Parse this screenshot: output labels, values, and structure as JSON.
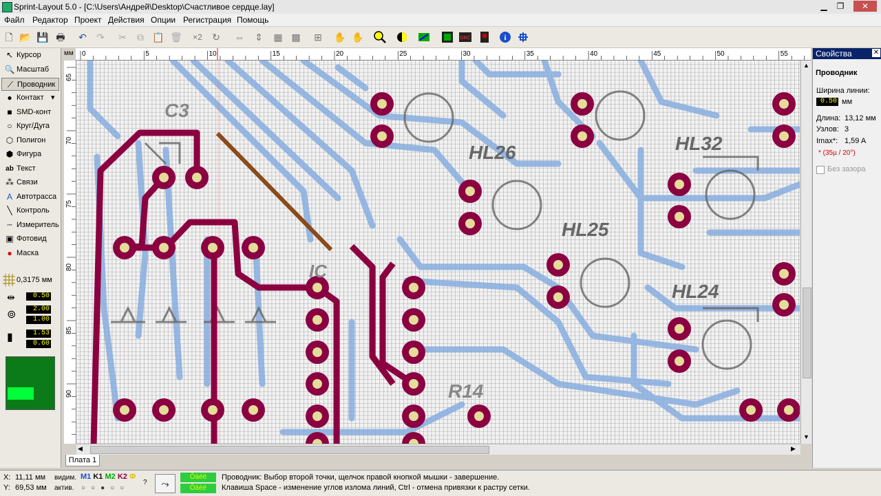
{
  "window": {
    "title": "Sprint-Layout 5.0 - [C:\\Users\\Андрей\\Desktop\\Счастливое сердце.lay]"
  },
  "menu": [
    "Файл",
    "Редактор",
    "Проект",
    "Действия",
    "Опции",
    "Регистрация",
    "Помощь"
  ],
  "toolbar": {
    "x2_label": "×2"
  },
  "tools": [
    {
      "label": "Курсор",
      "icon": "cursor-icon"
    },
    {
      "label": "Масштаб",
      "icon": "zoom-icon"
    },
    {
      "label": "Проводник",
      "icon": "track-icon"
    },
    {
      "label": "Контакт",
      "icon": "pad-icon"
    },
    {
      "label": "SMD-конт",
      "icon": "smd-icon"
    },
    {
      "label": "Круг/Дуга",
      "icon": "circle-icon"
    },
    {
      "label": "Полигон",
      "icon": "polygon-icon"
    },
    {
      "label": "Фигура",
      "icon": "shape-icon"
    },
    {
      "label": "Текст",
      "icon": "text-icon"
    },
    {
      "label": "Связи",
      "icon": "connections-icon"
    },
    {
      "label": "Автотрасса",
      "icon": "autoroute-icon"
    },
    {
      "label": "Контроль",
      "icon": "check-icon"
    },
    {
      "label": "Измеритель",
      "icon": "measure-icon"
    },
    {
      "label": "Фотовид",
      "icon": "photoview-icon"
    },
    {
      "label": "Маска",
      "icon": "mask-icon"
    }
  ],
  "grid": {
    "value": "0,3175 мм"
  },
  "track_width": "0.50",
  "pad_outer": "2.00",
  "pad_inner": "1.00",
  "smd_w": "1.53",
  "smd_h": "0.60",
  "ruler": {
    "unit": "мм",
    "h_labels": [
      "0",
      "5",
      "10",
      "15",
      "20",
      "25",
      "30",
      "35",
      "40",
      "45",
      "50",
      "55"
    ],
    "v_labels": [
      "65",
      "70",
      "75",
      "80",
      "85",
      "90"
    ]
  },
  "silk": {
    "labels": [
      "C3",
      "HL26",
      "HL25",
      "HL24",
      "HL32",
      "R14",
      "IC"
    ]
  },
  "tabs": {
    "board1": "Плата 1"
  },
  "props": {
    "header": "Свойства",
    "title": "Проводник",
    "width_label": "Ширина линии:",
    "width_value": "0.50",
    "width_unit": "мм",
    "length_label": "Длина:",
    "length_value": "13,12 мм",
    "nodes_label": "Узлов:",
    "nodes_value": "3",
    "imax_label": "Imax*:",
    "imax_value": "1,59 A",
    "note": "* (35µ / 20°)",
    "no_gap_label": "Без зазора"
  },
  "status": {
    "x_label": "X:",
    "x_value": "11,11 мм",
    "y_label": "Y:",
    "y_value": "69,53 мм",
    "visible_label": "видим.",
    "active_label": "актив.",
    "layers": [
      "M1",
      "K1",
      "M2",
      "K2",
      "Ф"
    ],
    "hint1": "Проводник: Выбор второй точки, щелчок правой кнопкой мышки - завершение.",
    "hint2": "Клавиша Space - изменение углов излома линий, Ctrl - отмена привязки к растру сетки.",
    "green1": "Ôàéë",
    "green2": "Ôàéë"
  }
}
